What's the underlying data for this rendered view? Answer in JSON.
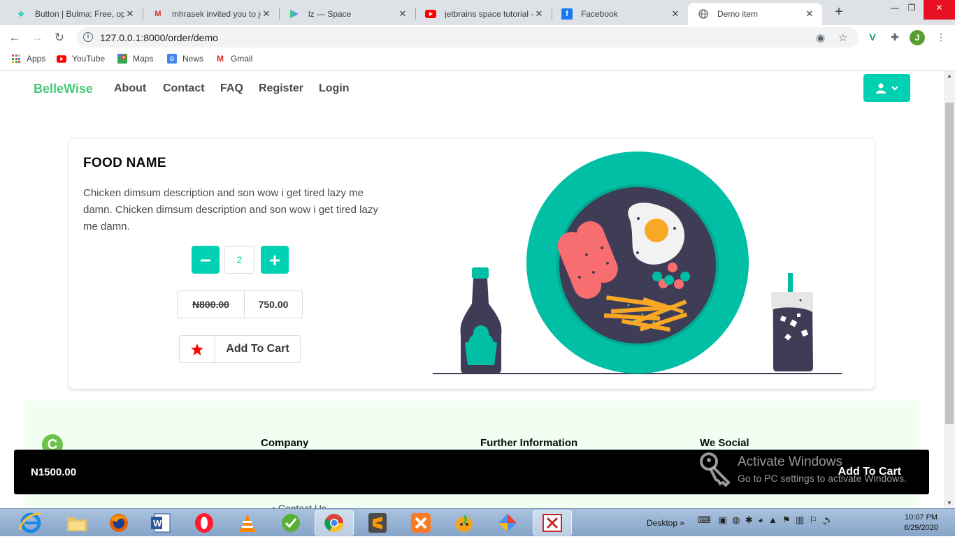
{
  "browser": {
    "tabs": [
      {
        "title": "Button | Bulma: Free, ope",
        "icon": "bulma-icon",
        "color": "#00d1b2"
      },
      {
        "title": "mhrasek invited you to jo",
        "icon": "gmail-icon",
        "color": "#d93025"
      },
      {
        "title": "lz — Space",
        "icon": "space-icon",
        "color": "#5b8def"
      },
      {
        "title": "jetbrains space tutorial -",
        "icon": "youtube-icon",
        "color": "#ff0000"
      },
      {
        "title": "Facebook",
        "icon": "facebook-icon",
        "color": "#1877f2"
      },
      {
        "title": "Demo item",
        "icon": "globe-icon",
        "color": "#5f6368",
        "active": true
      }
    ],
    "url": "127.0.0.1:8000/order/demo",
    "profile_initial": "J",
    "bookmarks": [
      {
        "label": "Apps",
        "icon": "apps-icon"
      },
      {
        "label": "YouTube",
        "icon": "youtube-icon"
      },
      {
        "label": "Maps",
        "icon": "maps-icon"
      },
      {
        "label": "News",
        "icon": "news-icon"
      },
      {
        "label": "Gmail",
        "icon": "gmail-icon"
      }
    ]
  },
  "site": {
    "brand": "BelleWise",
    "nav": [
      "About",
      "Contact",
      "FAQ",
      "Register",
      "Login"
    ],
    "accent_color": "#00d1b2",
    "brand_color": "#48c774"
  },
  "product": {
    "name": "FOOD NAME",
    "description": "Chicken dimsum description and son wow i get tired lazy me damn. Chicken dimsum description and son wow i get tired lazy me damn.",
    "quantity": "2",
    "old_price": "N800.00",
    "new_price": "750.00",
    "add_to_cart": "Add To Cart"
  },
  "footer": {
    "logo_letter": "C",
    "headings": [
      "Company",
      "Further Information",
      "We Social"
    ],
    "partial_link": "Contact Us"
  },
  "cart_bar": {
    "total": "N1500.00",
    "button": "Add To Cart"
  },
  "watermark": {
    "line1": "Activate Windows",
    "line2": "Go to PC settings to activate Windows."
  },
  "taskbar": {
    "desktop_label": "Desktop",
    "time": "10:07 PM",
    "date": "6/29/2020"
  }
}
